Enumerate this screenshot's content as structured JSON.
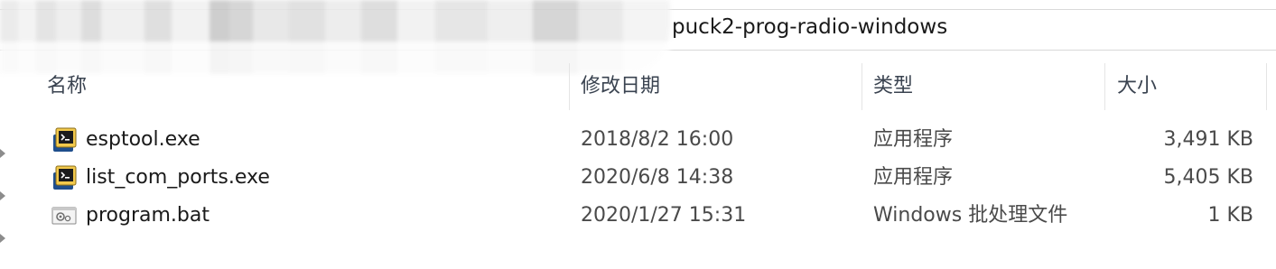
{
  "address": {
    "current_folder": "puck2-prog-radio-windows"
  },
  "columns": {
    "name": "名称",
    "date": "修改日期",
    "type": "类型",
    "size": "大小"
  },
  "files": [
    {
      "name": "esptool.exe",
      "date": "2018/8/2 16:00",
      "type": "应用程序",
      "size": "3,491 KB",
      "icon": "application-exe-icon"
    },
    {
      "name": "list_com_ports.exe",
      "date": "2020/6/8 14:38",
      "type": "应用程序",
      "size": "5,405 KB",
      "icon": "application-exe-icon"
    },
    {
      "name": "program.bat",
      "date": "2020/1/27 15:31",
      "type": "Windows 批处理文件",
      "size": "1 KB",
      "icon": "batch-file-icon"
    }
  ],
  "colors": {
    "header_text": "#3a4350",
    "row_text": "#1a1a1a",
    "divider": "#e5e5e5"
  }
}
